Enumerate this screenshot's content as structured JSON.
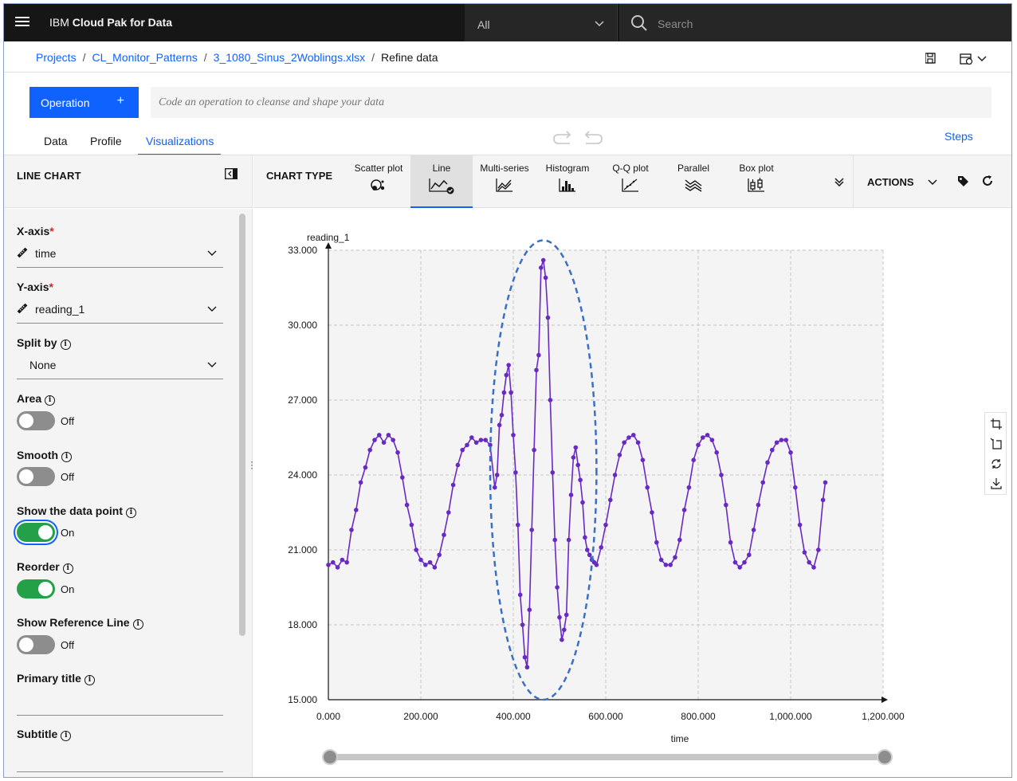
{
  "header": {
    "brand_prefix": "IBM",
    "brand_name": "Cloud Pak for Data",
    "scope_value": "All",
    "search_placeholder": "Search"
  },
  "breadcrumb": {
    "items": [
      "Projects",
      "CL_Monitor_Patterns",
      "3_1080_Sinus_2Woblings.xlsx"
    ],
    "current": "Refine data"
  },
  "operation": {
    "button_label": "Operation",
    "button_plus": "+",
    "input_placeholder": "Code an operation to cleanse and shape your data"
  },
  "tabs": [
    {
      "label": "Data",
      "active": false
    },
    {
      "label": "Profile",
      "active": false
    },
    {
      "label": "Visualizations",
      "active": true
    }
  ],
  "steps_label": "Steps",
  "left_panel": {
    "title": "LINE CHART",
    "x_axis_label": "X-axis",
    "x_axis_value": "time",
    "y_axis_label": "Y-axis",
    "y_axis_value": "reading_1",
    "split_by_label": "Split by",
    "split_by_value": "None",
    "area_label": "Area",
    "area_state": "Off",
    "smooth_label": "Smooth",
    "smooth_state": "Off",
    "show_points_label": "Show the data point",
    "show_points_state": "On",
    "reorder_label": "Reorder",
    "reorder_state": "On",
    "ref_line_label": "Show Reference Line",
    "ref_line_state": "Off",
    "primary_title_label": "Primary title",
    "subtitle_label": "Subtitle",
    "required_mark": "*",
    "info_glyph": "i"
  },
  "chart_types": {
    "label": "CHART TYPE",
    "items": [
      "Scatter plot",
      "Line",
      "Multi-series",
      "Histogram",
      "Q-Q plot",
      "Parallel",
      "Box plot"
    ],
    "selected": "Line",
    "actions_label": "ACTIONS"
  },
  "colors": {
    "accent": "#0f62fe",
    "series": "#6929c4",
    "annotation": "#3b6fc2",
    "toggle_on": "#24a148"
  },
  "chart_data": {
    "type": "line",
    "title": "",
    "xlabel": "time",
    "ylabel": "reading_1",
    "xlim": [
      0,
      1200
    ],
    "ylim": [
      15,
      33
    ],
    "x_ticks": [
      "0.000",
      "200.000",
      "400.000",
      "600.000",
      "800.000",
      "1,000.000",
      "1,200.000"
    ],
    "y_ticks": [
      "15.000",
      "18.000",
      "21.000",
      "24.000",
      "27.000",
      "30.000",
      "33.000"
    ],
    "grid": true,
    "show_points": true,
    "annotation": {
      "type": "dashed-ellipse",
      "x_range": [
        350,
        580
      ],
      "y_range": [
        15,
        33.4
      ]
    },
    "series": [
      {
        "x": [
          0,
          10,
          20,
          30,
          40,
          50,
          60,
          70,
          80,
          90,
          100,
          110,
          120,
          130,
          140,
          150,
          160,
          170,
          180,
          190,
          200,
          210,
          220,
          230,
          240,
          250,
          260,
          270,
          280,
          290,
          300,
          310,
          320,
          330,
          340,
          350,
          360,
          365,
          370,
          375,
          380,
          385,
          390,
          395,
          400,
          405,
          410,
          415,
          420,
          425,
          430,
          435,
          440,
          445,
          450,
          455,
          460,
          465,
          470,
          475,
          480,
          485,
          490,
          495,
          500,
          505,
          510,
          515,
          520,
          525,
          530,
          535,
          540,
          545,
          550,
          555,
          560,
          565,
          570,
          575,
          580,
          590,
          600,
          610,
          620,
          630,
          640,
          650,
          660,
          670,
          680,
          690,
          700,
          710,
          720,
          730,
          740,
          750,
          760,
          770,
          780,
          790,
          800,
          810,
          820,
          830,
          840,
          850,
          860,
          870,
          880,
          890,
          900,
          910,
          920,
          930,
          940,
          950,
          960,
          970,
          980,
          990,
          1000,
          1010,
          1020,
          1030,
          1040,
          1050,
          1060,
          1070,
          1075
        ],
        "values": [
          20.4,
          20.5,
          20.3,
          20.6,
          20.5,
          21.8,
          22.6,
          23.7,
          24.3,
          25.0,
          25.4,
          25.6,
          25.3,
          25.6,
          25.4,
          24.9,
          23.9,
          22.8,
          22.0,
          21.0,
          20.6,
          20.4,
          20.5,
          20.3,
          20.8,
          21.6,
          22.5,
          23.6,
          24.4,
          25.0,
          25.2,
          25.5,
          25.3,
          25.4,
          25.4,
          25.2,
          23.5,
          24.0,
          26.0,
          26.4,
          27.3,
          28.0,
          28.4,
          27.3,
          25.6,
          24.1,
          22.0,
          19.2,
          18.0,
          16.7,
          16.3,
          18.6,
          21.8,
          25.0,
          28.2,
          28.8,
          32.3,
          32.6,
          31.9,
          30.3,
          27.0,
          24.1,
          21.4,
          19.5,
          18.3,
          17.4,
          17.8,
          18.4,
          21.4,
          23.2,
          24.7,
          25.1,
          24.4,
          23.8,
          22.9,
          21.5,
          21.0,
          20.8,
          20.6,
          20.5,
          20.4,
          21.1,
          22.0,
          23.0,
          24.0,
          24.8,
          25.3,
          25.5,
          25.6,
          25.3,
          24.6,
          23.5,
          22.5,
          21.3,
          20.6,
          20.4,
          20.4,
          20.7,
          21.4,
          22.6,
          23.5,
          24.6,
          25.2,
          25.5,
          25.6,
          25.4,
          24.9,
          24.0,
          22.8,
          21.3,
          20.5,
          20.3,
          20.5,
          20.8,
          21.8,
          22.8,
          23.7,
          24.5,
          25.0,
          25.3,
          25.4,
          25.4,
          24.9,
          23.5,
          22.0,
          20.9,
          20.5,
          20.3,
          21.0,
          23.0,
          23.7
        ]
      }
    ]
  }
}
